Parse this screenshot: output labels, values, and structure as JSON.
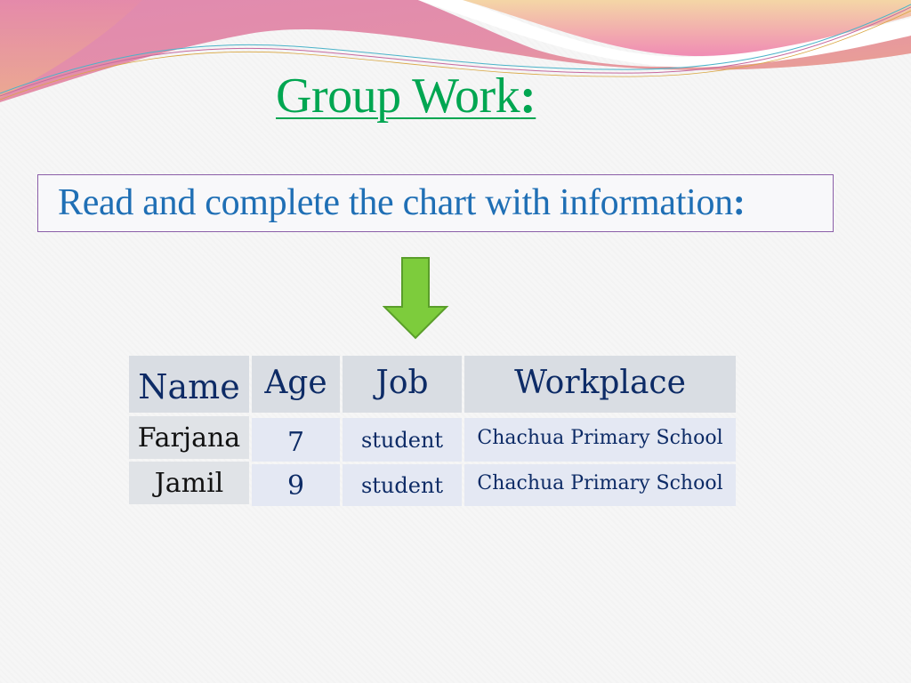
{
  "slide": {
    "title": "Group Work",
    "title_punct": ":",
    "instruction": "Read and complete the chart with information",
    "instruction_punct": ":",
    "colors": {
      "title": "#00a651",
      "instruction": "#1f6fb5",
      "box_border": "#8b5ea8",
      "arrow_fill": "#7dcc3c",
      "arrow_stroke": "#5a9e2a",
      "table_text": "#0d2b66"
    }
  },
  "table": {
    "headers": [
      "Name",
      "Age",
      "Job",
      "Workplace"
    ],
    "rows": [
      {
        "name": "Farjana",
        "age": "7",
        "job": "student",
        "workplace": "Chachua Primary School"
      },
      {
        "name": "Jamil",
        "age": "9",
        "job": "student",
        "workplace": "Chachua Primary School"
      }
    ]
  }
}
